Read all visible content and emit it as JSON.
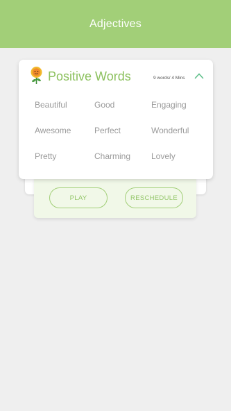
{
  "header": {
    "title": "Adjectives"
  },
  "card": {
    "title": "Positive Words",
    "meta": "9 words/ 4 Mins",
    "words": [
      "Beautiful",
      "Good",
      "Engaging",
      "Awesome",
      "Perfect",
      "Wonderful",
      "Pretty",
      "Charming",
      "Lovely"
    ]
  },
  "actions": {
    "play_label": "PLAY",
    "reschedule_label": "RESCHEDULE"
  },
  "icons": {
    "card_icon": "sunflower-icon",
    "toggle_icon": "chevron-up-icon"
  },
  "colors": {
    "header_bg": "#a2cf78",
    "accent": "#8cc15e",
    "action_bg": "#f1f8e8",
    "background": "#efefef"
  }
}
